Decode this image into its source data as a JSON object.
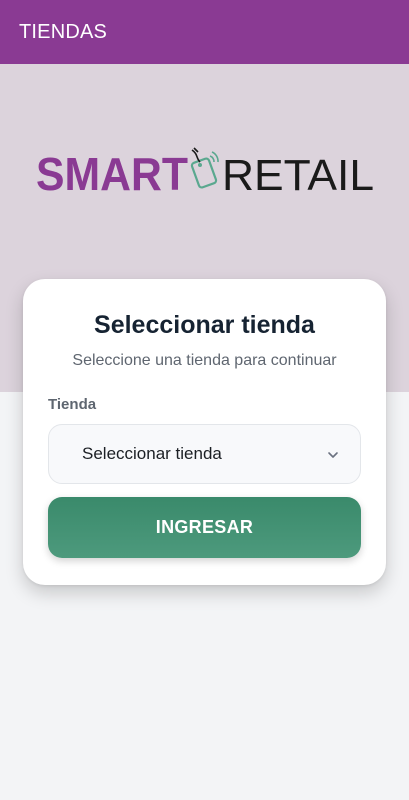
{
  "appbar": {
    "title": "TIENDAS",
    "color": "#8a3a93"
  },
  "logo": {
    "text_left": "SMART",
    "text_right": "RETAIL",
    "left_color": "#8a3a93",
    "right_color": "#1a1a1a",
    "tag_color": "#5aa88f"
  },
  "card": {
    "title": "Seleccionar tienda",
    "subtitle": "Seleccione una tienda para continuar",
    "field_label": "Tienda",
    "select_value": "Seleccionar tienda",
    "submit_label": "INGRESAR"
  },
  "colors": {
    "hero_background": "#dcd3dc",
    "page_background": "#f3f4f6",
    "button": "#3f8f70"
  },
  "icons": {
    "select": "chevron-down-icon",
    "logo": "price-tag-icon"
  }
}
